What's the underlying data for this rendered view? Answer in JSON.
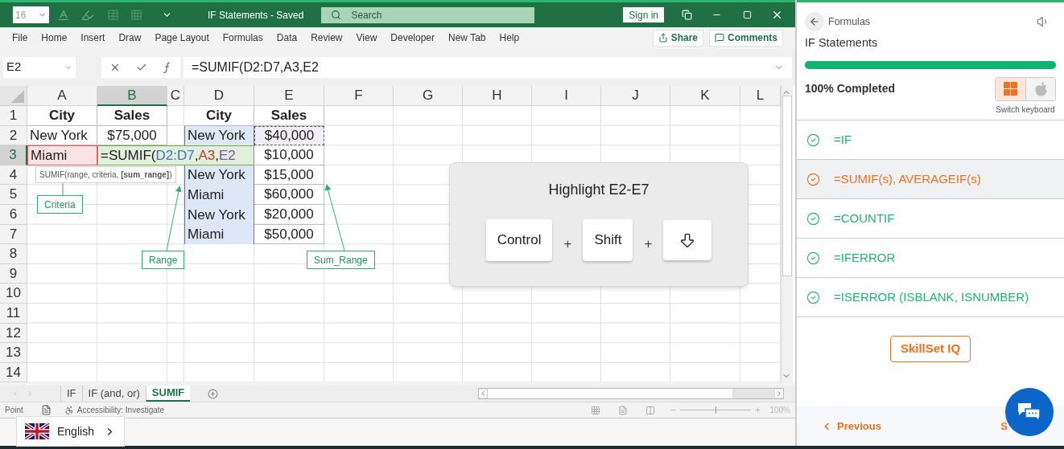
{
  "toolbar": {
    "font_size": "16",
    "title": "IF Statements - Saved",
    "search_placeholder": "Search",
    "sign_in": "Sign in"
  },
  "ribbon": {
    "tabs": [
      "File",
      "Home",
      "Insert",
      "Draw",
      "Page Layout",
      "Formulas",
      "Data",
      "Review",
      "View",
      "Developer",
      "New Tab",
      "Help"
    ],
    "share": "Share",
    "comments": "Comments"
  },
  "formula_bar": {
    "name_box": "E2",
    "formula": "=SUMIF(D2:D7,A3,E2"
  },
  "sheet": {
    "columns": [
      {
        "label": "A",
        "selected": false
      },
      {
        "label": "B",
        "selected": true
      },
      {
        "label": "C",
        "selected": false
      },
      {
        "label": "D",
        "selected": false
      },
      {
        "label": "E",
        "selected": false
      },
      {
        "label": "F",
        "selected": false
      },
      {
        "label": "G",
        "selected": false
      },
      {
        "label": "H",
        "selected": false
      },
      {
        "label": "I",
        "selected": false
      },
      {
        "label": "J",
        "selected": false
      },
      {
        "label": "K",
        "selected": false
      },
      {
        "label": "L",
        "selected": false
      }
    ],
    "rows": [
      {
        "label": "1",
        "selected": false,
        "cells": {
          "a": {
            "kind": "text",
            "text": "City",
            "bold": true
          },
          "b": {
            "kind": "text",
            "text": "Sales",
            "bold": true
          },
          "d": {
            "kind": "text",
            "text": "City",
            "bold": true
          },
          "e": {
            "kind": "text",
            "text": "Sales",
            "bold": true
          }
        }
      },
      {
        "label": "2",
        "selected": false,
        "cells": {
          "a": {
            "kind": "text",
            "text": "New York",
            "bold": false
          },
          "b": {
            "kind": "text",
            "text": "$75,000",
            "bold": false
          },
          "d": {
            "kind": "text",
            "text": "New York",
            "bold": false,
            "in_range": true
          },
          "e": {
            "kind": "text",
            "text": "$40,000",
            "bold": false,
            "copy_marquee": true
          }
        }
      },
      {
        "label": "3",
        "selected": true,
        "cells": {
          "a": {
            "kind": "text",
            "text": "Miami",
            "bold": false,
            "criteria": true
          },
          "b": {
            "kind": "formula",
            "parts": [
              {
                "text": "=SUMIF("
              },
              {
                "text": "D2:D7",
                "color": "#3a78c9"
              },
              {
                "text": ","
              },
              {
                "text": "A3",
                "color": "#c0392b"
              },
              {
                "text": ","
              },
              {
                "text": "E2",
                "color": "#7a55b0"
              }
            ]
          },
          "e": {
            "kind": "text",
            "text": "$10,000",
            "bold": false
          }
        }
      },
      {
        "label": "4",
        "selected": false,
        "cells": {
          "d": {
            "kind": "text",
            "text": "New York",
            "bold": false,
            "in_range": true
          },
          "e": {
            "kind": "text",
            "text": "$15,000",
            "bold": false
          }
        }
      },
      {
        "label": "5",
        "selected": false,
        "cells": {
          "d": {
            "kind": "text",
            "text": "Miami",
            "bold": false,
            "in_range": true
          },
          "e": {
            "kind": "text",
            "text": "$60,000",
            "bold": false
          }
        }
      },
      {
        "label": "6",
        "selected": false,
        "cells": {
          "d": {
            "kind": "text",
            "text": "New York",
            "bold": false,
            "in_range": true
          },
          "e": {
            "kind": "text",
            "text": "$20,000",
            "bold": false
          }
        }
      },
      {
        "label": "7",
        "selected": false,
        "cells": {
          "d": {
            "kind": "text",
            "text": "Miami",
            "bold": false,
            "in_range": true
          },
          "e": {
            "kind": "text",
            "text": "$50,000",
            "bold": false
          }
        }
      },
      {
        "label": "8",
        "selected": false
      },
      {
        "label": "9",
        "selected": false
      },
      {
        "label": "10",
        "selected": false
      },
      {
        "label": "11",
        "selected": false
      },
      {
        "label": "12",
        "selected": false
      },
      {
        "label": "13",
        "selected": false
      },
      {
        "label": "14",
        "selected": false
      }
    ]
  },
  "annotations": {
    "tooltip": "SUMIF(range, criteria, **[sum_range]**)",
    "callouts": [
      "Criteria",
      "Range",
      "Sum_Range"
    ]
  },
  "shortcut": {
    "title": "Highlight E2-E7",
    "keys": [
      {
        "kind": "label",
        "label": "Control"
      },
      {
        "kind": "label",
        "label": "Shift"
      },
      {
        "kind": "arrow-down"
      }
    ],
    "separators": [
      "+",
      "+"
    ]
  },
  "sheet_tabs": [
    {
      "label": "IF",
      "selected": false
    },
    {
      "label": "IF (and, or)",
      "selected": false
    },
    {
      "label": "SUMIF",
      "selected": true
    }
  ],
  "status_bar": {
    "mode": "Point",
    "accessibility": "Accessibility: Investigate",
    "zoom": {
      "level": 0.5,
      "reading": "100%"
    }
  },
  "language": {
    "label": "English"
  },
  "panel": {
    "breadcrumb": "Formulas",
    "title": "IF Statements",
    "progress": {
      "level": 1,
      "reading": "100% Completed"
    },
    "keyboard": {
      "options": [
        {
          "kind": "windows",
          "selected": true
        },
        {
          "kind": "apple",
          "selected": false
        }
      ],
      "caption": "Switch keyboard"
    },
    "lessons": [
      {
        "label": "=IF",
        "selected": false
      },
      {
        "label": "=SUMIF(s), AVERAGEIF(s)",
        "selected": true
      },
      {
        "label": "=COUNTIF",
        "selected": false
      },
      {
        "label": "=IFERROR",
        "selected": false
      },
      {
        "label": "=ISERROR (ISBLANK, ISNUMBER)",
        "selected": false
      }
    ],
    "skillset": "SkillSet IQ",
    "previous": "Previous",
    "next": "S"
  }
}
